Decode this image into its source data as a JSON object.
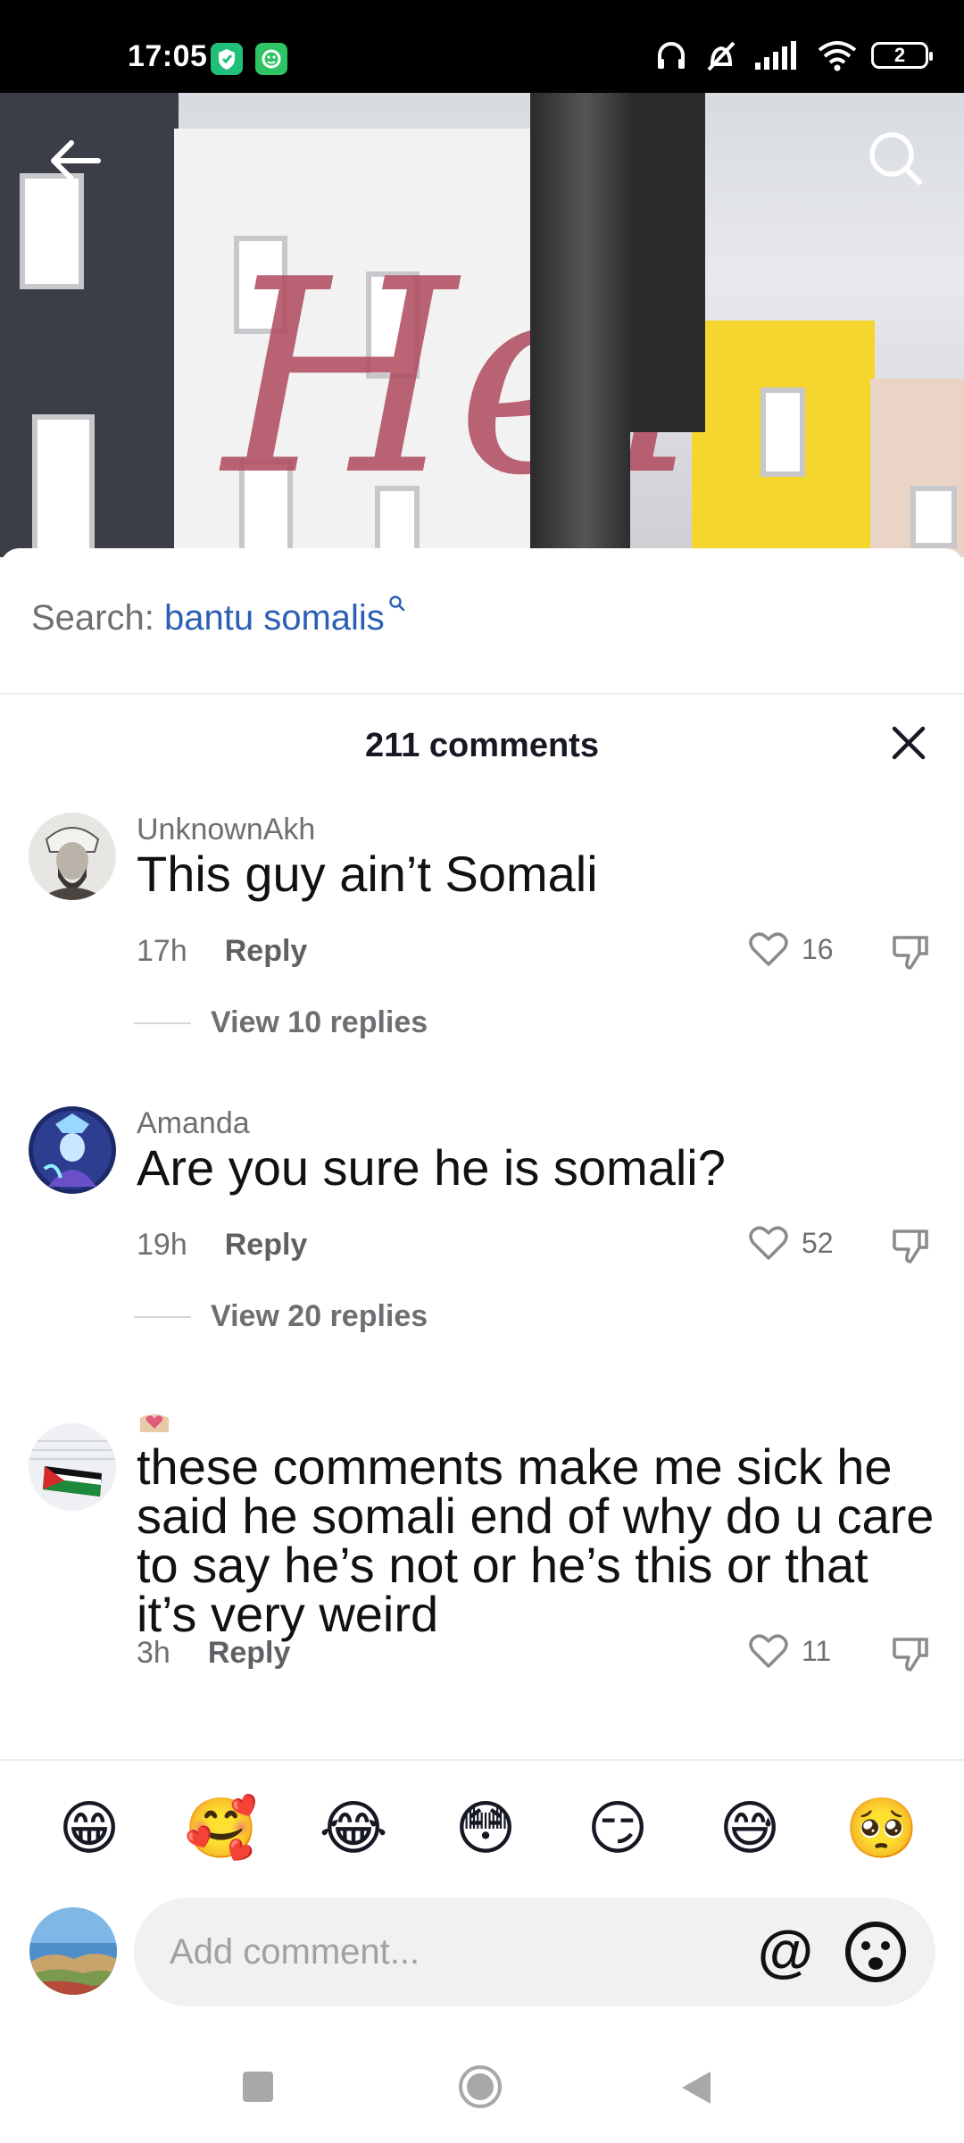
{
  "status_bar": {
    "time": "17:05",
    "battery": "2"
  },
  "search": {
    "label": "Search:",
    "term": "bantu somalis"
  },
  "comments_header": {
    "title": "211 comments"
  },
  "comments": [
    {
      "user": "UnknownAkh",
      "text": "This guy ain’t Somali",
      "time": "17h",
      "reply_label": "Reply",
      "likes": "16",
      "view_replies": "View 10 replies"
    },
    {
      "user": "Amanda",
      "text": "Are you sure he is somali?",
      "time": "19h",
      "reply_label": "Reply",
      "likes": "52",
      "view_replies": "View 20 replies"
    },
    {
      "user": "",
      "text": "these comments make me sick he said he somali end of why do u care to say he’s not or he’s this or that it’s very weird",
      "time": "3h",
      "reply_label": "Reply",
      "likes": "11"
    }
  ],
  "emojis": [
    "😁",
    "🥰",
    "😂",
    "😳",
    "😏",
    "😅",
    "🥺"
  ],
  "composer": {
    "placeholder": "Add comment...",
    "at_symbol": "@"
  },
  "colors": {
    "link_blue": "#2b5fb4",
    "text_gray": "#6f6f73",
    "status_bg": "#000000"
  }
}
